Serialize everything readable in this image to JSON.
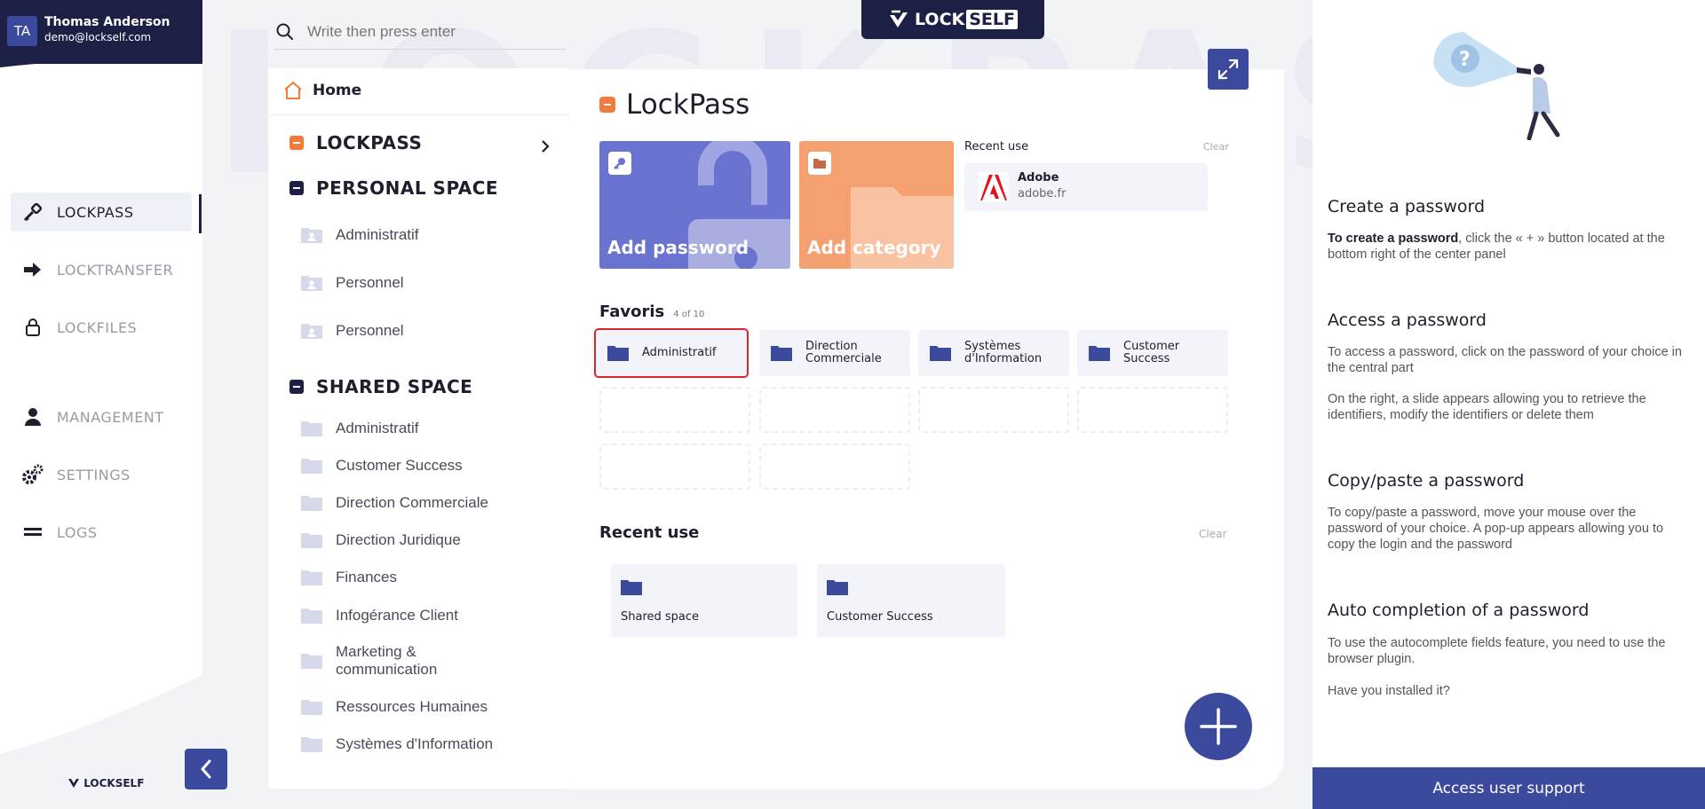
{
  "user": {
    "initials": "TA",
    "name": "Thomas Anderson",
    "email": "demo@lockself.com"
  },
  "nav": {
    "items": [
      {
        "label": "LOCKPASS",
        "icon": "key-icon",
        "active": true
      },
      {
        "label": "LOCKTRANSFER",
        "icon": "arrow-right-icon",
        "active": false
      },
      {
        "label": "LOCKFILES",
        "icon": "lock-icon",
        "active": false
      },
      {
        "label": "MANAGEMENT",
        "icon": "user-icon",
        "active": false
      },
      {
        "label": "SETTINGS",
        "icon": "gears-icon",
        "active": false
      },
      {
        "label": "LOGS",
        "icon": "logs-icon",
        "active": false
      }
    ],
    "bottom_logo": "LOCKSELF"
  },
  "watermark": "LOCKPASS",
  "search": {
    "placeholder": "Write then press enter"
  },
  "top_logo": {
    "lock": "LOCK",
    "self": "SELF"
  },
  "tree": {
    "home": "Home",
    "lockpass": "LOCKPASS",
    "personal_space": {
      "title": "PERSONAL SPACE",
      "items": [
        "Administratif",
        "Personnel",
        "Personnel"
      ]
    },
    "shared_space": {
      "title": "SHARED SPACE",
      "items": [
        "Administratif",
        "Customer Success",
        "Direction Commerciale",
        "Direction Juridique",
        "Finances",
        "Infogérance Client",
        "Marketing & communication",
        "Ressources Humaines",
        "Systèmes d'Information"
      ]
    }
  },
  "main": {
    "title": "LockPass",
    "add_password": "Add password",
    "add_category": "Add category",
    "recent_top": {
      "label": "Recent use",
      "clear": "Clear",
      "item": {
        "name": "Adobe",
        "url": "adobe.fr"
      }
    },
    "favorites": {
      "title": "Favoris",
      "count": "4 of 10",
      "items": [
        "Administratif",
        "Direction Commerciale",
        "Systèmes d'Information",
        "Customer Success"
      ]
    },
    "recent_use": {
      "title": "Recent use",
      "clear": "Clear",
      "items": [
        "Shared space",
        "Customer Success"
      ]
    }
  },
  "help": {
    "sections": [
      {
        "title": "Create a password",
        "bold": "To create a password",
        "text": ", click the « + » button located at the bottom right of the center panel"
      },
      {
        "title": "Access a password",
        "text": "To access a password, click on the password of your choice in the central part",
        "text2": "On the right, a slide appears allowing you to retrieve the identifiers, modify the identifiers or delete them"
      },
      {
        "title": "Copy/paste a password",
        "text": "To copy/paste a password, move your mouse over the password of your choice. A pop-up appears allowing you to copy the login and the password"
      },
      {
        "title": "Auto completion of a password",
        "text": "To use the autocomplete fields feature, you need to use the browser plugin.",
        "text2": "Have you installed it?"
      }
    ],
    "support_button": "Access user support"
  },
  "colors": {
    "navy": "#1d2045",
    "accent": "#3c4a9e",
    "orange": "#f27b3a",
    "purple_tile": "#6b73d1",
    "orange_tile": "#f5a070",
    "folder": "#3c4a9e",
    "folder_light": "#d6d9ea",
    "highlight": "#d9262c"
  }
}
